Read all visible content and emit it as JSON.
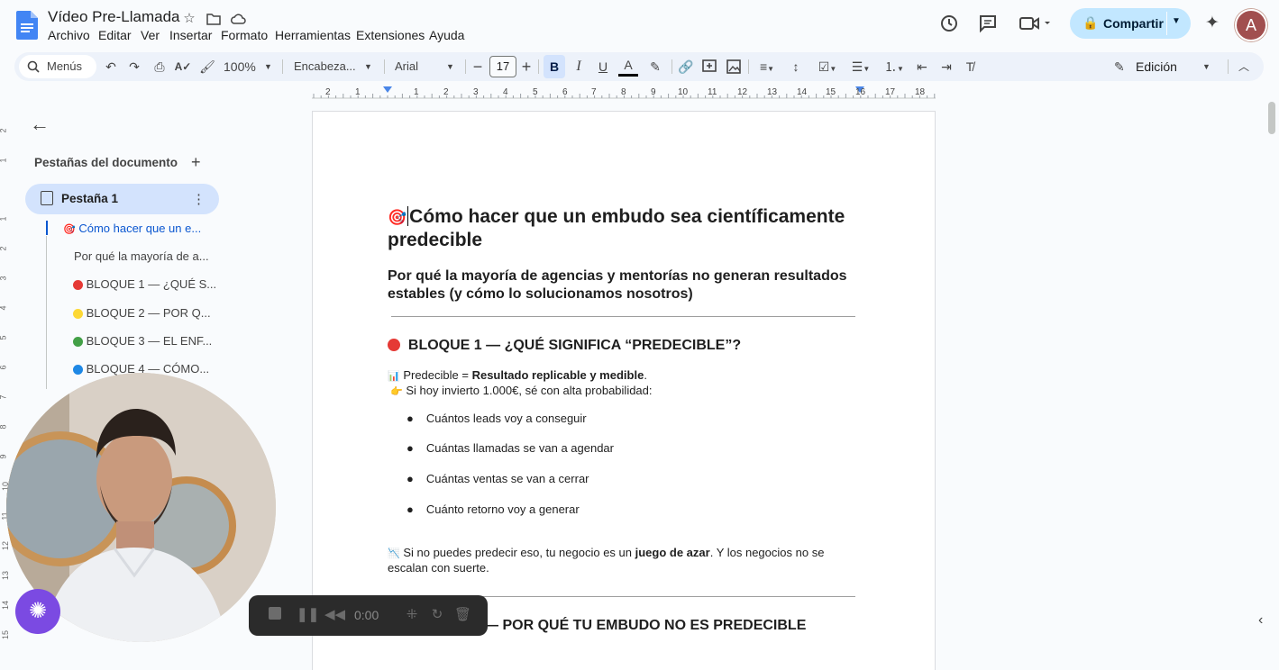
{
  "doc": {
    "title": "Vídeo Pre-Llamada",
    "menu": [
      "Archivo",
      "Editar",
      "Ver",
      "Insertar",
      "Formato",
      "Herramientas",
      "Extensiones",
      "Ayuda"
    ],
    "share_label": "Compartir",
    "avatar_initial": "A"
  },
  "toolbar": {
    "search_label": "Menús",
    "zoom": "100%",
    "style": "Encabeza...",
    "font": "Arial",
    "font_size": "17",
    "bold_label": "B",
    "italic_label": "I",
    "underline_label": "U",
    "text_color_label": "A",
    "mode": "Edición"
  },
  "ruler": [
    "2",
    "1",
    "1",
    "2",
    "3",
    "4",
    "5",
    "6",
    "7",
    "8",
    "9",
    "10",
    "11",
    "12",
    "13",
    "14",
    "15",
    "16",
    "17",
    "18"
  ],
  "vruler": [
    "2",
    "1",
    "1",
    "2",
    "3",
    "4",
    "5",
    "6",
    "7",
    "8",
    "9",
    "10",
    "11",
    "12",
    "13",
    "14",
    "15"
  ],
  "sidebar": {
    "title": "Pestañas del documento",
    "tab_label": "Pestaña 1",
    "outline": [
      "Cómo hacer que un e...",
      "Por qué la mayoría de a...",
      "BLOQUE 1 — ¿QUÉ S...",
      "BLOQUE 2 — POR Q...",
      "BLOQUE 3 — EL ENF...",
      "BLOQUE 4 — CÓMO..."
    ]
  },
  "content": {
    "h1_line1": "Cómo hacer que un embudo sea científicamente",
    "h1_line2": "predecible",
    "h2_line1": "Por qué la mayoría de agencias y mentorías no generan resultados",
    "h2_line2": "estables (y cómo lo solucionamos nosotros)",
    "block1_title": "BLOQUE 1 — ¿QUÉ SIGNIFICA “PREDECIBLE”?",
    "p1_pre": "Predecible = ",
    "p1_bold": "Resultado replicable y medible",
    "p1_post": ".",
    "p2": "Si hoy invierto 1.000€, sé con alta probabilidad:",
    "bullets": [
      "Cuántos leads voy a conseguir",
      "Cuántas llamadas se van a agendar",
      "Cuántas ventas se van a cerrar",
      "Cuánto retorno voy a generar"
    ],
    "p3_pre": "Si no puedes predecir eso, tu negocio es un ",
    "p3_bold": "juego de azar",
    "p3_post": ". Y los negocios no se",
    "p3_line2": "escalan con suerte.",
    "block2_title": "— POR QUÉ TU EMBUDO NO ES PREDECIBLE"
  },
  "recorder": {
    "time": "0:00"
  },
  "colors": {
    "accent": "#0b57d0",
    "share_bg": "#c2e7ff",
    "tab_bg": "#d3e3fd",
    "red_dot": "#e53935",
    "yellow_dot": "#fdd835",
    "green_dot": "#43a047",
    "blue_dot": "#1e88e5",
    "settings_bubble": "#7b4ae2"
  },
  "icons": [
    "docs-logo-icon",
    "star-icon",
    "folder-icon",
    "cloud-icon",
    "history-icon",
    "comment-icon",
    "meet-icon",
    "lock-icon",
    "gemini-icon",
    "search-icon",
    "undo-icon",
    "redo-icon",
    "print-icon",
    "spellcheck-icon",
    "paint-format-icon",
    "link-icon",
    "add-comment-icon",
    "image-icon",
    "align-icon",
    "line-spacing-icon",
    "checklist-icon",
    "bullet-list-icon",
    "numbered-list-icon",
    "indent-decrease-icon",
    "indent-increase-icon",
    "clear-format-icon",
    "pencil-icon",
    "collapse-icon",
    "back-arrow-icon",
    "plus-icon",
    "more-icon",
    "target-icon",
    "chart-icon",
    "pointing-hand-icon",
    "chart-down-icon",
    "settings-icon",
    "stop-icon",
    "pause-icon",
    "rewind-icon",
    "grid-icon",
    "restart-icon",
    "trash-icon"
  ]
}
